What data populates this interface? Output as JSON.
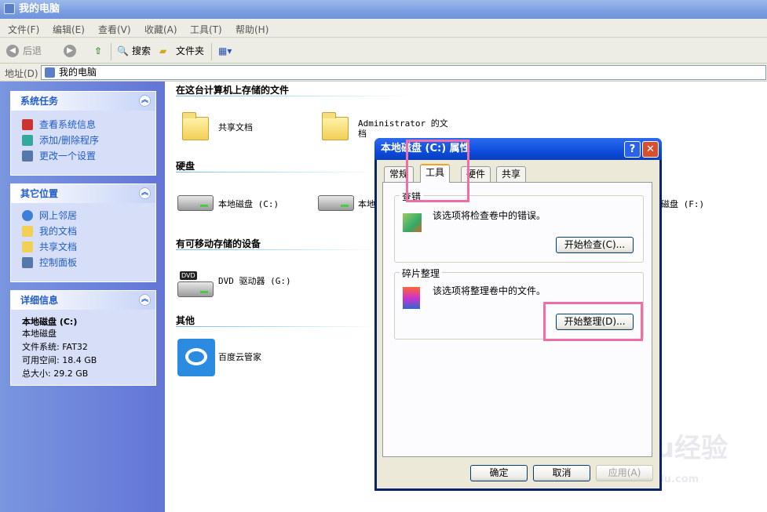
{
  "window": {
    "title": "我的电脑"
  },
  "menu": [
    "文件(F)",
    "编辑(E)",
    "查看(V)",
    "收藏(A)",
    "工具(T)",
    "帮助(H)"
  ],
  "toolbar": {
    "back": "后退",
    "search": "搜索",
    "folders": "文件夹"
  },
  "address": {
    "label": "地址(D)",
    "value": "我的电脑"
  },
  "sidebar": {
    "system_tasks": {
      "title": "系统任务",
      "items": [
        "查看系统信息",
        "添加/删除程序",
        "更改一个设置"
      ]
    },
    "other_places": {
      "title": "其它位置",
      "items": [
        "网上邻居",
        "我的文档",
        "共享文档",
        "控制面板"
      ]
    },
    "details": {
      "title": "详细信息",
      "name": "本地磁盘 (C:)",
      "type": "本地磁盘",
      "fs": "文件系统: FAT32",
      "free": "可用空间: 18.4 GB",
      "total": "总大小: 29.2 GB"
    }
  },
  "main": {
    "sections": {
      "stored": "在这台计算机上存储的文件",
      "hdd": "硬盘",
      "removable": "有可移动存储的设备",
      "other": "其他"
    },
    "items": {
      "shared_docs": "共享文档",
      "admin_docs_1": "Administrator 的文",
      "admin_docs_2": "档",
      "drive_c": "本地磁盘 (C:)",
      "drive_d": "本地",
      "drive_f": "磁盘 (F:)",
      "dvd": "DVD 驱动器 (G:)",
      "dvd_icon": "DVD",
      "baidu": "百度云管家"
    }
  },
  "dialog": {
    "title": "本地磁盘 (C:) 属性",
    "help": "?",
    "close": "✕",
    "tabs": [
      "常规",
      "工具",
      "硬件",
      "共享"
    ],
    "check": {
      "group": "查错",
      "desc": "该选项将检查卷中的错误。",
      "button": "开始检查(C)..."
    },
    "defrag": {
      "group": "碎片整理",
      "desc": "该选项将整理卷中的文件。",
      "button": "开始整理(D)..."
    },
    "ok": "确定",
    "cancel": "取消",
    "apply": "应用(A)"
  },
  "watermark": {
    "brand": "Baidu经验",
    "url": "jingyan.baidu.com"
  }
}
